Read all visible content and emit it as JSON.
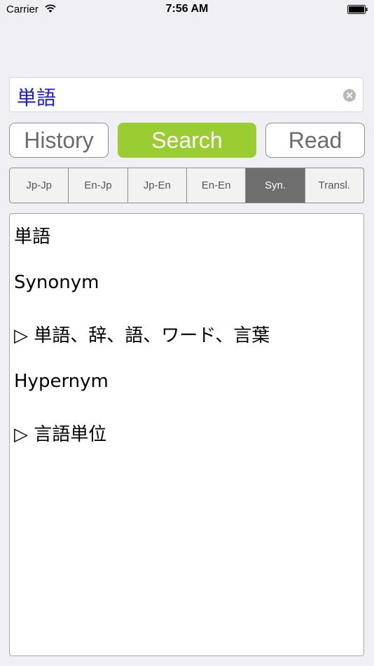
{
  "status": {
    "carrier": "Carrier",
    "time": "7:56 AM"
  },
  "search": {
    "value": "単語"
  },
  "modes": {
    "history": "History",
    "search": "Search",
    "read": "Read"
  },
  "dictionaries": [
    {
      "label": "Jp-Jp"
    },
    {
      "label": "En-Jp"
    },
    {
      "label": "Jp-En"
    },
    {
      "label": "En-En"
    },
    {
      "label": "Syn."
    },
    {
      "label": "Transl."
    }
  ],
  "result": {
    "headword": "単語",
    "synonym_heading": "Synonym",
    "synonyms": "▷ 単語、辞、語、ワード、言葉",
    "hypernym_heading": "Hypernym",
    "hypernyms": "▷ 言語単位"
  },
  "colors": {
    "accent": "#9acd32",
    "selected_segment": "#6e6e6e",
    "query_text": "#1b1bd6"
  }
}
